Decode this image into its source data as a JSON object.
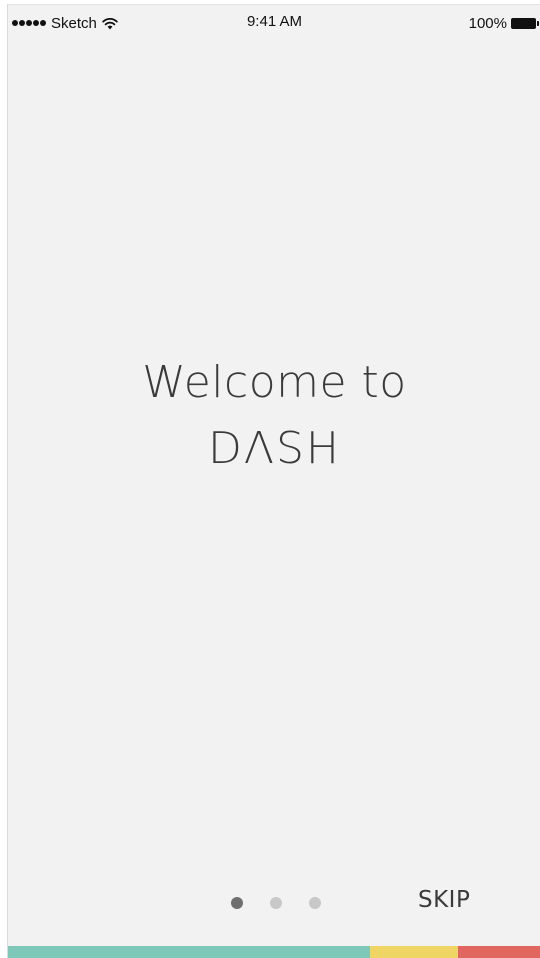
{
  "status_bar": {
    "carrier": "Sketch",
    "time": "9:41 AM",
    "battery_percent": "100%",
    "signal_bars_filled": 5,
    "icons": [
      "signal-dots-icon",
      "wifi-icon",
      "battery-icon"
    ]
  },
  "welcome": {
    "line1": "Welcome to",
    "brand": "DΛSH"
  },
  "pager": {
    "total_pages": 3,
    "current_page": 1
  },
  "skip": {
    "label": "SKIP"
  },
  "colors": {
    "background": "#f2f2f2",
    "text": "#3a3a3a",
    "dot_active": "#6f6f6f",
    "dot_inactive": "#c8c8c8",
    "bar_teal": "#7dc8b8",
    "bar_yellow": "#efd564",
    "bar_red": "#e0665f"
  },
  "color_bar": {
    "segments": [
      {
        "name": "teal",
        "color": "#7dc8b8",
        "fraction": 0.68
      },
      {
        "name": "yellow",
        "color": "#efd564",
        "fraction": 0.165
      },
      {
        "name": "red",
        "color": "#e0665f",
        "fraction": 0.155
      }
    ]
  }
}
